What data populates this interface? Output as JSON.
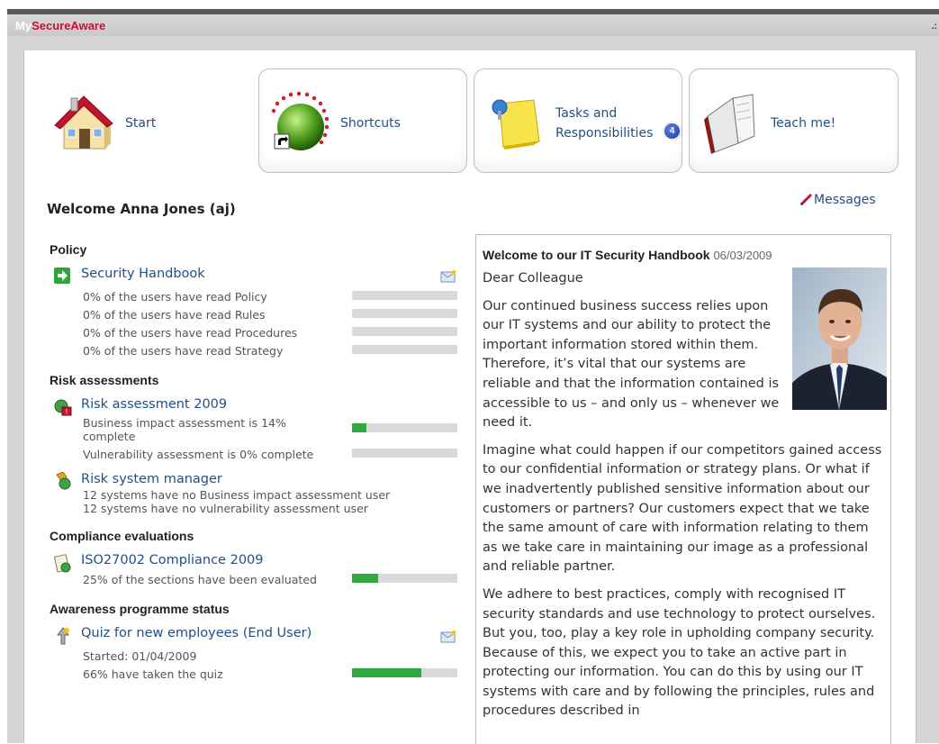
{
  "app": {
    "title_prefix": "My",
    "title_main": "SecureAware",
    "corner": ".:"
  },
  "nav": [
    {
      "label": "Start",
      "icon": "house-icon"
    },
    {
      "label": "Shortcuts",
      "icon": "shortcut-globe-icon"
    },
    {
      "label_line1": "Tasks and",
      "label_line2": "Responsibilities",
      "badge": "4",
      "icon": "notepad-pin-icon"
    },
    {
      "label": "Teach me!",
      "icon": "book-icon"
    }
  ],
  "welcome": "Welcome Anna Jones (aj)",
  "messages_label": "Messages",
  "sections": {
    "policy": {
      "heading": "Policy",
      "item": "Security Handbook",
      "rows": [
        {
          "text": "0% of the users have read Policy",
          "progress": 0
        },
        {
          "text": "0% of the users have read Rules",
          "progress": 0
        },
        {
          "text": "0% of the users have read Procedures",
          "progress": 0
        },
        {
          "text": "0% of the users have read Strategy",
          "progress": 0
        }
      ]
    },
    "risk": {
      "heading": "Risk assessments",
      "item1": "Risk assessment 2009",
      "row1_line1": "Business impact assessment is 14%",
      "row1_line2": "complete",
      "row1_progress": 0.14,
      "row2": "Vulnerability assessment is 0% complete",
      "row2_progress": 0,
      "item2": "Risk system manager",
      "sys1": "12 systems have no Business impact assessment user",
      "sys2": "12 systems have no vulnerability assessment user"
    },
    "compliance": {
      "heading": "Compliance evaluations",
      "item": "ISO27002 Compliance 2009",
      "row": "25% of the sections have been evaluated",
      "progress": 0.25
    },
    "awareness": {
      "heading": "Awareness programme status",
      "item": "Quiz for new employees (End User)",
      "started": "Started: 01/04/2009",
      "row": "66% have taken the quiz",
      "progress": 0.66
    }
  },
  "article": {
    "title": "Welcome to our IT Security Handbook",
    "date": "06/03/2009",
    "greeting": "Dear Colleague",
    "p1": "Our continued business success relies upon our IT systems and our ability to protect the important information stored within them. Therefore, it’s vital that our systems are reliable and that the information contained is accessible to us – and only us – whenever we need it.",
    "p2": "Imagine what could happen if our competitors gained access to our confidential information or strategy plans. Or what if we inadvertently published sensitive information about our customers or partners? Our customers expect that we take the same amount of care with information relating to them as we take care in maintaining our image as a professional and reliable partner.",
    "p3": "We adhere to best practices, comply with recognised IT security standards and use technology to protect ourselves. But you, too, play a key role in upholding company security. Because of this, we expect you to take an active part in protecting our information. You can do this by using our IT systems with care and by following the principles, rules and procedures described in"
  },
  "colors": {
    "link": "#1f4f86",
    "brand_red": "#c4122f",
    "progress_fill": "#2eaa3c",
    "progress_track": "#d9d9d9"
  }
}
